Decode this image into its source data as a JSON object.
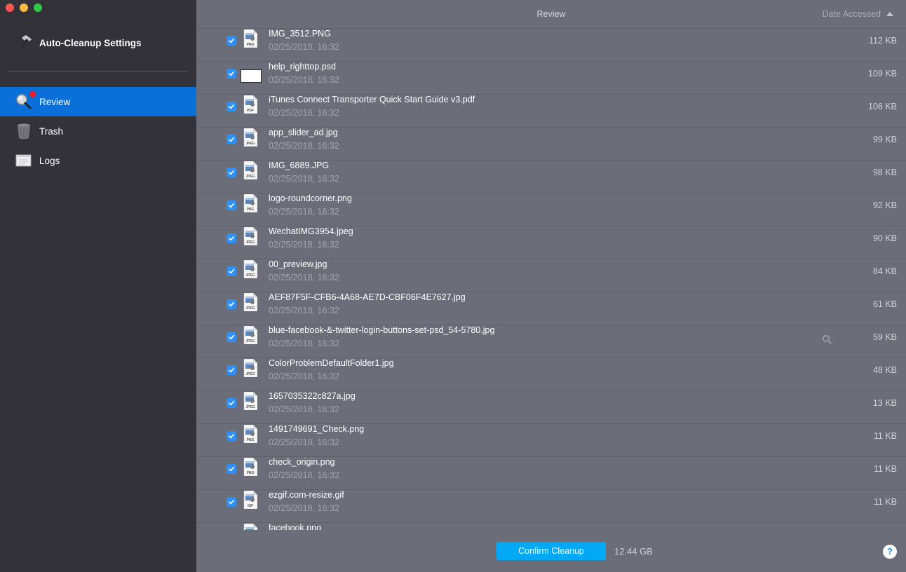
{
  "window": {
    "controls": [
      "close",
      "minimize",
      "maximize"
    ]
  },
  "sidebar": {
    "settings_label": "Auto-Cleanup Settings",
    "settings_icon": "hammer-icon",
    "items": [
      {
        "label": "Review",
        "icon": "magnifier-icon",
        "active": true,
        "badge": true
      },
      {
        "label": "Trash",
        "icon": "trash-icon",
        "active": false
      },
      {
        "label": "Logs",
        "icon": "logs-icon",
        "active": false
      }
    ]
  },
  "header": {
    "title": "Review",
    "sort_label": "Date Accessed",
    "sort_direction": "ascending"
  },
  "files": [
    {
      "name": "IMG_3512.PNG",
      "date": "02/25/2018, 16:32",
      "size": "112 KB",
      "type": "PNG",
      "checked": true
    },
    {
      "name": "help_righttop.psd",
      "date": "02/25/2018, 16:32",
      "size": "109 KB",
      "type": "blank",
      "checked": true
    },
    {
      "name": "iTunes Connect Transporter Quick Start Guide v3.pdf",
      "date": "02/25/2018, 16:32",
      "size": "106 KB",
      "type": "PDF",
      "checked": true
    },
    {
      "name": "app_slider_ad.jpg",
      "date": "02/25/2018, 16:32",
      "size": "99 KB",
      "type": "JPEG",
      "checked": true
    },
    {
      "name": "IMG_6889.JPG",
      "date": "02/25/2018, 16:32",
      "size": "98 KB",
      "type": "JPEG",
      "checked": true
    },
    {
      "name": "logo-roundcorner.png",
      "date": "02/25/2018, 16:32",
      "size": "92 KB",
      "type": "PNG",
      "checked": true
    },
    {
      "name": "WechatIMG3954.jpeg",
      "date": "02/25/2018, 16:32",
      "size": "90 KB",
      "type": "JPEG",
      "checked": true
    },
    {
      "name": "00_preview.jpg",
      "date": "02/25/2018, 16:32",
      "size": "84 KB",
      "type": "JPEG",
      "checked": true
    },
    {
      "name": "AEF87F5F-CFB6-4A68-AE7D-CBF06F4E7627.jpg",
      "date": "02/25/2018, 16:32",
      "size": "61 KB",
      "type": "JPEG",
      "checked": true
    },
    {
      "name": "blue-facebook-&-twitter-login-buttons-set-psd_54-5780.jpg",
      "date": "02/25/2018, 16:32",
      "size": "59 KB",
      "type": "JPEG",
      "checked": true,
      "hover_preview": true
    },
    {
      "name": "ColorProblemDefaultFolder1.jpg",
      "date": "02/25/2018, 16:32",
      "size": "48 KB",
      "type": "JPEG",
      "checked": true
    },
    {
      "name": "1657035322c827a.jpg",
      "date": "02/25/2018, 16:32",
      "size": "13 KB",
      "type": "JPEG",
      "checked": true
    },
    {
      "name": "1491749691_Check.png",
      "date": "02/25/2018, 16:32",
      "size": "11 KB",
      "type": "PNG",
      "checked": true
    },
    {
      "name": "check_origin.png",
      "date": "02/25/2018, 16:32",
      "size": "11 KB",
      "type": "PNG",
      "checked": true
    },
    {
      "name": "ezgif.com-resize.gif",
      "date": "02/25/2018, 16:32",
      "size": "11 KB",
      "type": "GIF",
      "checked": true
    },
    {
      "name": "facebook.png",
      "date": "",
      "size": "",
      "type": "PNG",
      "checked": true
    }
  ],
  "footer": {
    "confirm_label": "Confirm Cleanup",
    "total_size": "12.44 GB",
    "help_label": "?"
  },
  "colors": {
    "accent": "#0a6fd9",
    "button": "#03a9f4",
    "checkbox": "#2e8ff4",
    "badge": "#f01c25"
  }
}
